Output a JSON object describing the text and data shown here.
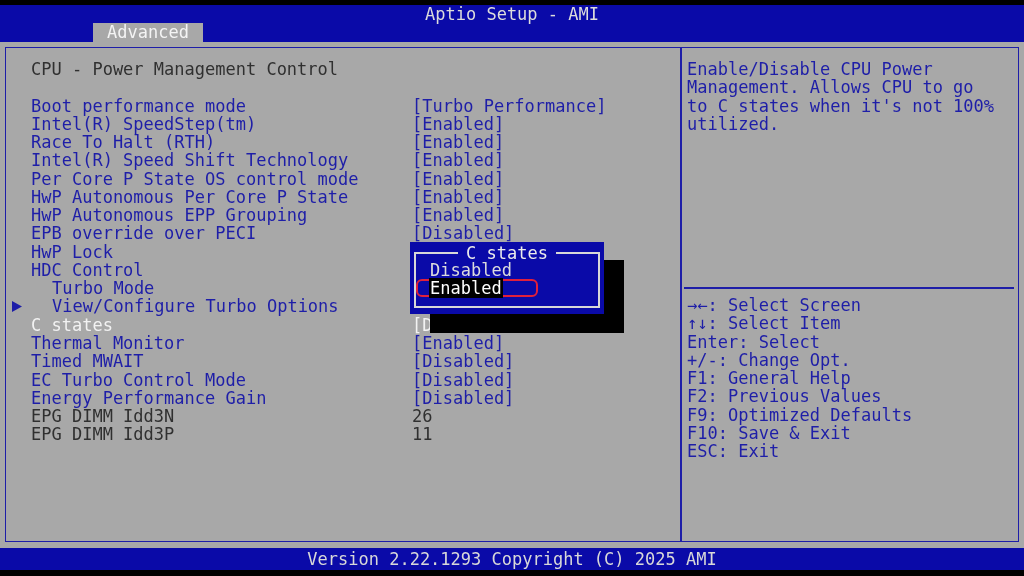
{
  "window": {
    "title": "Aptio Setup - AMI"
  },
  "tabs": [
    {
      "label": "Advanced",
      "selected": true
    }
  ],
  "menu": {
    "title": "CPU - Power Management Control",
    "items": [
      {
        "kind": "option",
        "label": "Boot performance mode",
        "value": "[Turbo Performance]",
        "selected": false
      },
      {
        "kind": "option",
        "label": "Intel(R) SpeedStep(tm)",
        "value": "[Enabled]",
        "selected": false
      },
      {
        "kind": "option",
        "label": "Race To Halt (RTH)",
        "value": "[Enabled]",
        "selected": false
      },
      {
        "kind": "option",
        "label": "Intel(R) Speed Shift Technology",
        "value": "[Enabled]",
        "selected": false
      },
      {
        "kind": "option",
        "label": "Per Core P State OS control mode",
        "value": "[Enabled]",
        "selected": false
      },
      {
        "kind": "option",
        "label": "HwP Autonomous Per Core P State",
        "value": "[Enabled]",
        "selected": false
      },
      {
        "kind": "option",
        "label": "HwP Autonomous EPP Grouping",
        "value": "[Enabled]",
        "selected": false
      },
      {
        "kind": "option",
        "label": "EPB override over PECI",
        "value": "[Disabled]",
        "selected": false
      },
      {
        "kind": "option",
        "label": "HwP Lock",
        "selected": false
      },
      {
        "kind": "option",
        "label": "HDC Control",
        "selected": false,
        "children": [
          {
            "kind": "option",
            "label": "Turbo Mode",
            "selected": false
          },
          {
            "kind": "submenu",
            "label": "View/Configure Turbo Options",
            "selected": false
          }
        ]
      },
      {
        "kind": "option",
        "label": "C states",
        "value": "[D",
        "selected": true
      },
      {
        "kind": "option",
        "label": "Thermal Monitor",
        "value": "[Enabled]",
        "selected": false
      },
      {
        "kind": "option",
        "label": "Timed MWAIT",
        "value": "[Disabled]",
        "selected": false
      },
      {
        "kind": "option",
        "label": "EC Turbo Control Mode",
        "value": "[Disabled]",
        "selected": false
      },
      {
        "kind": "option",
        "label": "Energy Performance Gain",
        "value": "[Disabled]",
        "selected": false
      },
      {
        "kind": "info",
        "label": "EPG DIMM Idd3N",
        "value": "26",
        "selected": false
      },
      {
        "kind": "info",
        "label": "EPG DIMM Idd3P",
        "value": "11",
        "selected": false
      }
    ]
  },
  "popup": {
    "title": "C states",
    "options": [
      {
        "label": "Disabled",
        "selected": false
      },
      {
        "label": "Enabled",
        "selected": true
      }
    ]
  },
  "help": {
    "description": "Enable/Disable CPU Power Management. Allows CPU to go to C states when it's not 100% utilized.",
    "keys": [
      "→←: Select Screen",
      "↑↓: Select Item",
      "Enter: Select",
      "+/-: Change Opt.",
      "F1: General Help",
      "F2: Previous Values",
      "F9: Optimized Defaults",
      "F10: Save & Exit",
      "ESC: Exit"
    ]
  },
  "status_bar": "Version 2.22.1293 Copyright (C) 2025 AMI"
}
